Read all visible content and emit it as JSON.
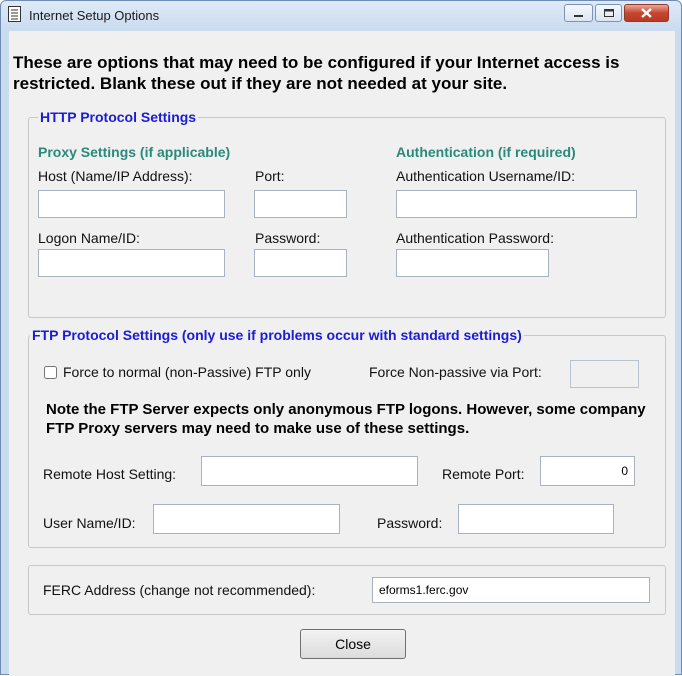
{
  "window": {
    "title": "Internet Setup Options"
  },
  "intro": {
    "text": "These are options that may need to be configured if your Internet access is restricted. Blank these out if they are not needed at your site."
  },
  "http": {
    "legend": "HTTP Protocol Settings",
    "proxy_heading": "Proxy Settings (if applicable)",
    "auth_heading": "Authentication (if required)",
    "host_label": "Host (Name/IP Address):",
    "host_value": "",
    "port_label": "Port:",
    "port_value": "",
    "logon_label": "Logon Name/ID:",
    "logon_value": "",
    "password_label": "Password:",
    "password_value": "",
    "auth_user_label": "Authentication Username/ID:",
    "auth_user_value": "",
    "auth_pass_label": "Authentication Password:",
    "auth_pass_value": ""
  },
  "ftp": {
    "legend": "FTP Protocol Settings (only use if problems occur with standard settings)",
    "force_normal_label": "Force to normal (non-Passive) FTP only",
    "force_normal_checked": false,
    "force_port_label": "Force Non-passive via Port:",
    "force_port_value": "",
    "note": "Note the FTP Server expects only anonymous FTP logons. However, some company FTP Proxy servers may need to make use of these settings.",
    "remote_host_label": "Remote Host Setting:",
    "remote_host_value": "",
    "remote_port_label": "Remote Port:",
    "remote_port_value": "0",
    "user_label": "User Name/ID:",
    "user_value": "",
    "password_label": "Password:",
    "password_value": ""
  },
  "ferc": {
    "label": "FERC Address (change not recommended):",
    "value": "eforms1.ferc.gov"
  },
  "buttons": {
    "close": "Close"
  }
}
